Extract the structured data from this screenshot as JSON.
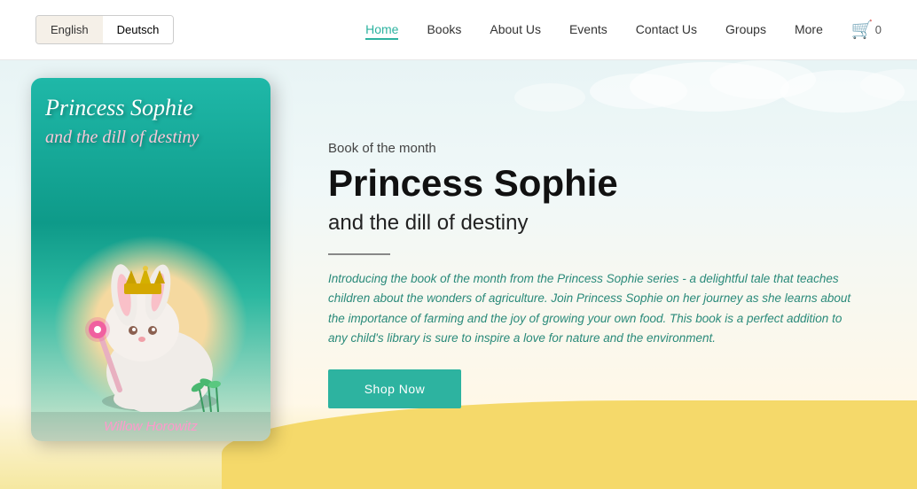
{
  "navbar": {
    "lang_en": "English",
    "lang_de": "Deutsch",
    "nav_items": [
      {
        "label": "Home",
        "active": true
      },
      {
        "label": "Books",
        "active": false
      },
      {
        "label": "About Us",
        "active": false
      },
      {
        "label": "Events",
        "active": false
      },
      {
        "label": "Contact Us",
        "active": false
      },
      {
        "label": "Groups",
        "active": false
      },
      {
        "label": "More",
        "active": false
      }
    ],
    "cart_count": "0"
  },
  "hero": {
    "book_of_month_label": "Book of the month",
    "book_main_title": "Princess Sophie",
    "book_subtitle": "and the dill of destiny",
    "description": "Introducing the book of the month from the Princess Sophie series - a delightful tale that teaches children about the wonders of agriculture. Join Princess Sophie on her journey as she learns about the importance of farming and the joy of growing your own food. This book is a perfect addition to any child's library is sure to inspire a love for nature and the environment.",
    "shop_now_label": "Shop Now",
    "book_cover_title_line1": "Princess Sophie",
    "book_cover_title_line2": "and the dill of destiny",
    "book_author": "Willow Horowitz"
  }
}
